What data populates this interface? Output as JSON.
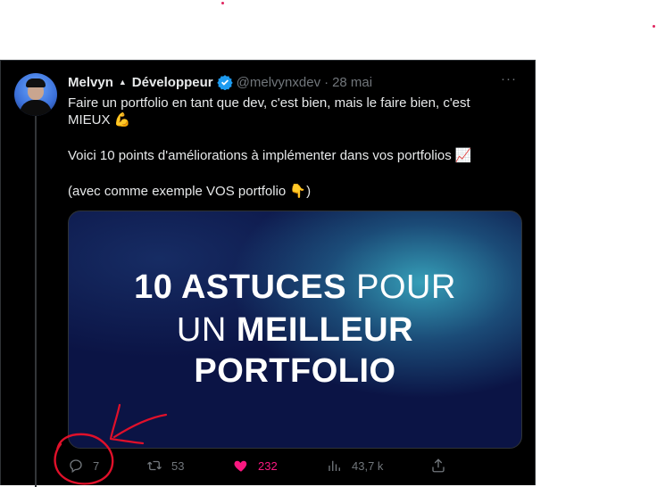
{
  "tweet": {
    "author_name": "Melvyn",
    "author_title": "Développeur",
    "handle": "@melvynxdev",
    "date": "28 mai",
    "more_label": "···",
    "text_line1": "Faire un portfolio en tant que dev, c'est bien, mais le faire bien, c'est",
    "text_line2": "MIEUX 💪",
    "text_line3": "Voici 10 points d'améliorations à implémenter dans vos portfolios 📈",
    "text_line4": "(avec comme exemple VOS portfolio 👇)",
    "media": {
      "line1_bold": "10 ASTUCES",
      "line1_light": "POUR",
      "line2_light": "UN",
      "line2_bold": "MEILLEUR",
      "line3_bold": "PORTFOLIO"
    },
    "actions": {
      "replies": "7",
      "retweets": "53",
      "likes": "232",
      "views": "43,7 k"
    }
  },
  "colors": {
    "background": "#000000",
    "text": "#e7e9ea",
    "muted": "#71767b",
    "like": "#f91880",
    "verified": "#1d9bf0",
    "annotation": "#e0102a"
  }
}
